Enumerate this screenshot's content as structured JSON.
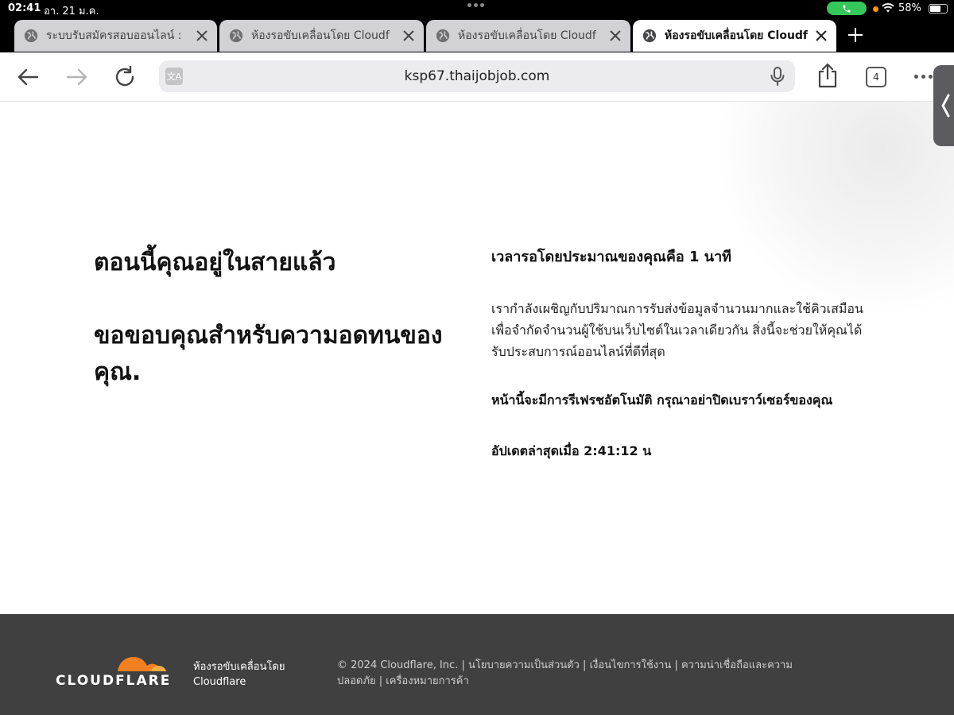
{
  "status_bar": {
    "time": "02:41",
    "date": "อา. 21 ม.ค.",
    "battery": "58%",
    "battery_level": 0.58
  },
  "tabs": [
    {
      "title": "ระบบรับสมัครสอบออนไลน์ :",
      "active": false
    },
    {
      "title": "ห้องรอขับเคลื่อนโดย Cloudf",
      "active": false
    },
    {
      "title": "ห้องรอขับเคลื่อนโดย Cloudf",
      "active": false
    },
    {
      "title": "ห้องรอขับเคลื่อนโดย Cloudf",
      "active": true
    }
  ],
  "toolbar": {
    "url": "ksp67.thaijobjob.com",
    "tab_count": "4"
  },
  "page": {
    "in_queue": "ตอนนี้คุณอยู่ในสายแล้ว",
    "thank_you": "ขอขอบคุณสำหรับความอดทนของคุณ.",
    "wait_time": "เวลารอโดยประมาณของคุณคือ 1 นาที",
    "description": "เรากำลังเผชิญกับปริมาณการรับส่งข้อมูลจำนวนมากและใช้คิวเสมือนเพื่อจำกัดจำนวนผู้ใช้บนเว็บไซต์ในเวลาเดียวกัน สิ่งนี้จะช่วยให้คุณได้รับประสบการณ์ออนไลน์ที่ดีที่สุด",
    "refresh_note": "หน้านี้จะมีการรีเฟรชอัตโนมัติ กรุณาอย่าปิดเบราว์เซอร์ของคุณ",
    "last_update": "อัปเดตล่าสุดเมื่อ 2:41:12 น"
  },
  "footer": {
    "brand": "CLOUDFLARE",
    "waiting_room": "ห้องรอขับเคลื่อนโดย Cloudflare",
    "copyright": "© 2024 Cloudflare, Inc. | นโยบายความเป็นส่วนตัว | เงื่อนไขการใช้งาน | ความน่าเชื่อถือและความปลอดภัย | เครื่องหมายการค้า"
  },
  "colors": {
    "footer_bg": "#404041",
    "cloudflare_orange": "#f38020",
    "cloudflare_orange_light": "#faae40",
    "call_green": "#34c759"
  }
}
